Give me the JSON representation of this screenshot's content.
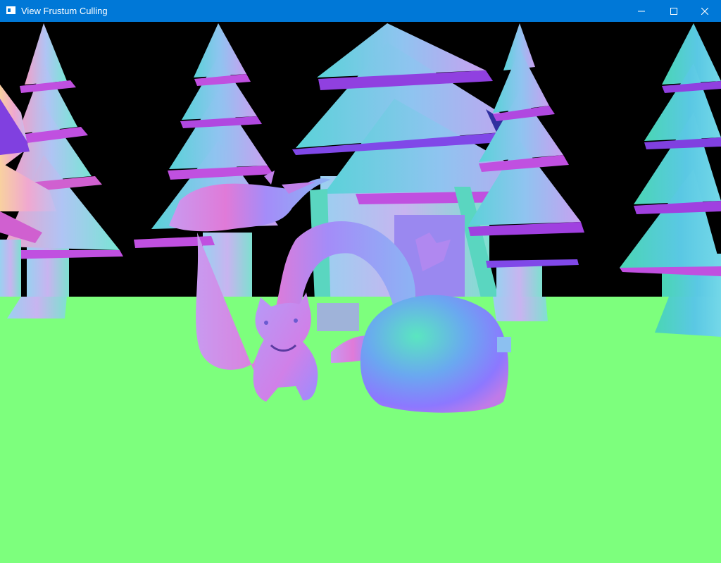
{
  "window": {
    "title": "View Frustum Culling",
    "app_icon": "window-app-icon",
    "controls": [
      "minimize-icon",
      "maximize-icon",
      "close-icon"
    ],
    "accent_color": "#0078d7"
  },
  "scene": {
    "description_icons": [
      "normal-shaded-trees",
      "dragon-model",
      "cat-model",
      "sphere-model"
    ],
    "colors": {
      "sky": "#000000",
      "ground": "#7dff7d",
      "tree_teal": "#5ad2c8",
      "tree_purple": "#8c5adc",
      "tree_pink": "#e678c8",
      "model_base": "#9a8cff"
    }
  }
}
